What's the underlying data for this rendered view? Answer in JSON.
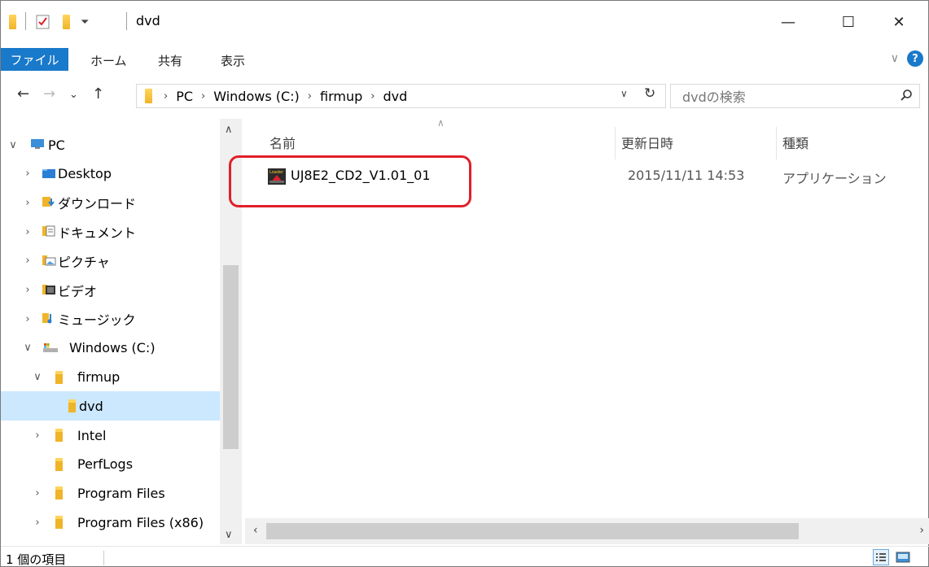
{
  "window": {
    "title": "dvd",
    "minimize": "—",
    "maximize": "☐",
    "close": "✕"
  },
  "ribbon": {
    "file_tab": "ファイル",
    "tabs": [
      "ホーム",
      "共有",
      "表示"
    ],
    "help": "?",
    "expand": "∨"
  },
  "address": {
    "back": "←",
    "forward": "→",
    "recent": "⌄",
    "up": "↑",
    "crumbs": [
      "PC",
      "Windows (C:)",
      "firmup",
      "dvd"
    ],
    "separator": "›",
    "dropdown": "∨",
    "refresh": "↻",
    "search_placeholder": "dvdの検索",
    "search_icon": "⚲"
  },
  "nav": {
    "items": [
      {
        "label": "PC",
        "arrow": "∨",
        "icon": "pc-icon"
      },
      {
        "label": "Desktop",
        "arrow": "›",
        "icon": "desktop-folder-icon"
      },
      {
        "label": "ダウンロード",
        "arrow": "›",
        "icon": "downloads-folder-icon"
      },
      {
        "label": "ドキュメント",
        "arrow": "›",
        "icon": "documents-folder-icon"
      },
      {
        "label": "ピクチャ",
        "arrow": "›",
        "icon": "pictures-folder-icon"
      },
      {
        "label": "ビデオ",
        "arrow": "›",
        "icon": "videos-folder-icon"
      },
      {
        "label": "ミュージック",
        "arrow": "›",
        "icon": "music-folder-icon"
      },
      {
        "label": "Windows (C:)",
        "arrow": "∨",
        "icon": "drive-icon"
      },
      {
        "label": "firmup",
        "arrow": "∨",
        "icon": "folder-icon"
      },
      {
        "label": "dvd",
        "arrow": "",
        "icon": "folder-icon"
      },
      {
        "label": "Intel",
        "arrow": "›",
        "icon": "folder-icon"
      },
      {
        "label": "PerfLogs",
        "arrow": "",
        "icon": "folder-icon"
      },
      {
        "label": "Program Files",
        "arrow": "›",
        "icon": "folder-icon"
      },
      {
        "label": "Program Files (x86)",
        "arrow": "›",
        "icon": "folder-icon"
      }
    ],
    "scroll_up": "∧",
    "scroll_down": "∨"
  },
  "content": {
    "columns": {
      "name": "名前",
      "modified": "更新日時",
      "type": "種類"
    },
    "sort_caret": "∧",
    "files": [
      {
        "name": "UJ8E2_CD2_V1.01_01",
        "modified": "2015/11/11 14:53",
        "type": "アプリケーション",
        "icon": "loader-app-icon"
      }
    ],
    "hscroll_left": "‹",
    "hscroll_right": "›"
  },
  "status": {
    "item_count": "1 個の項目"
  },
  "colors": {
    "accent": "#1979ca",
    "selection": "#cce8ff",
    "highlight_border": "#e0202a",
    "folder": "#f0b429"
  }
}
